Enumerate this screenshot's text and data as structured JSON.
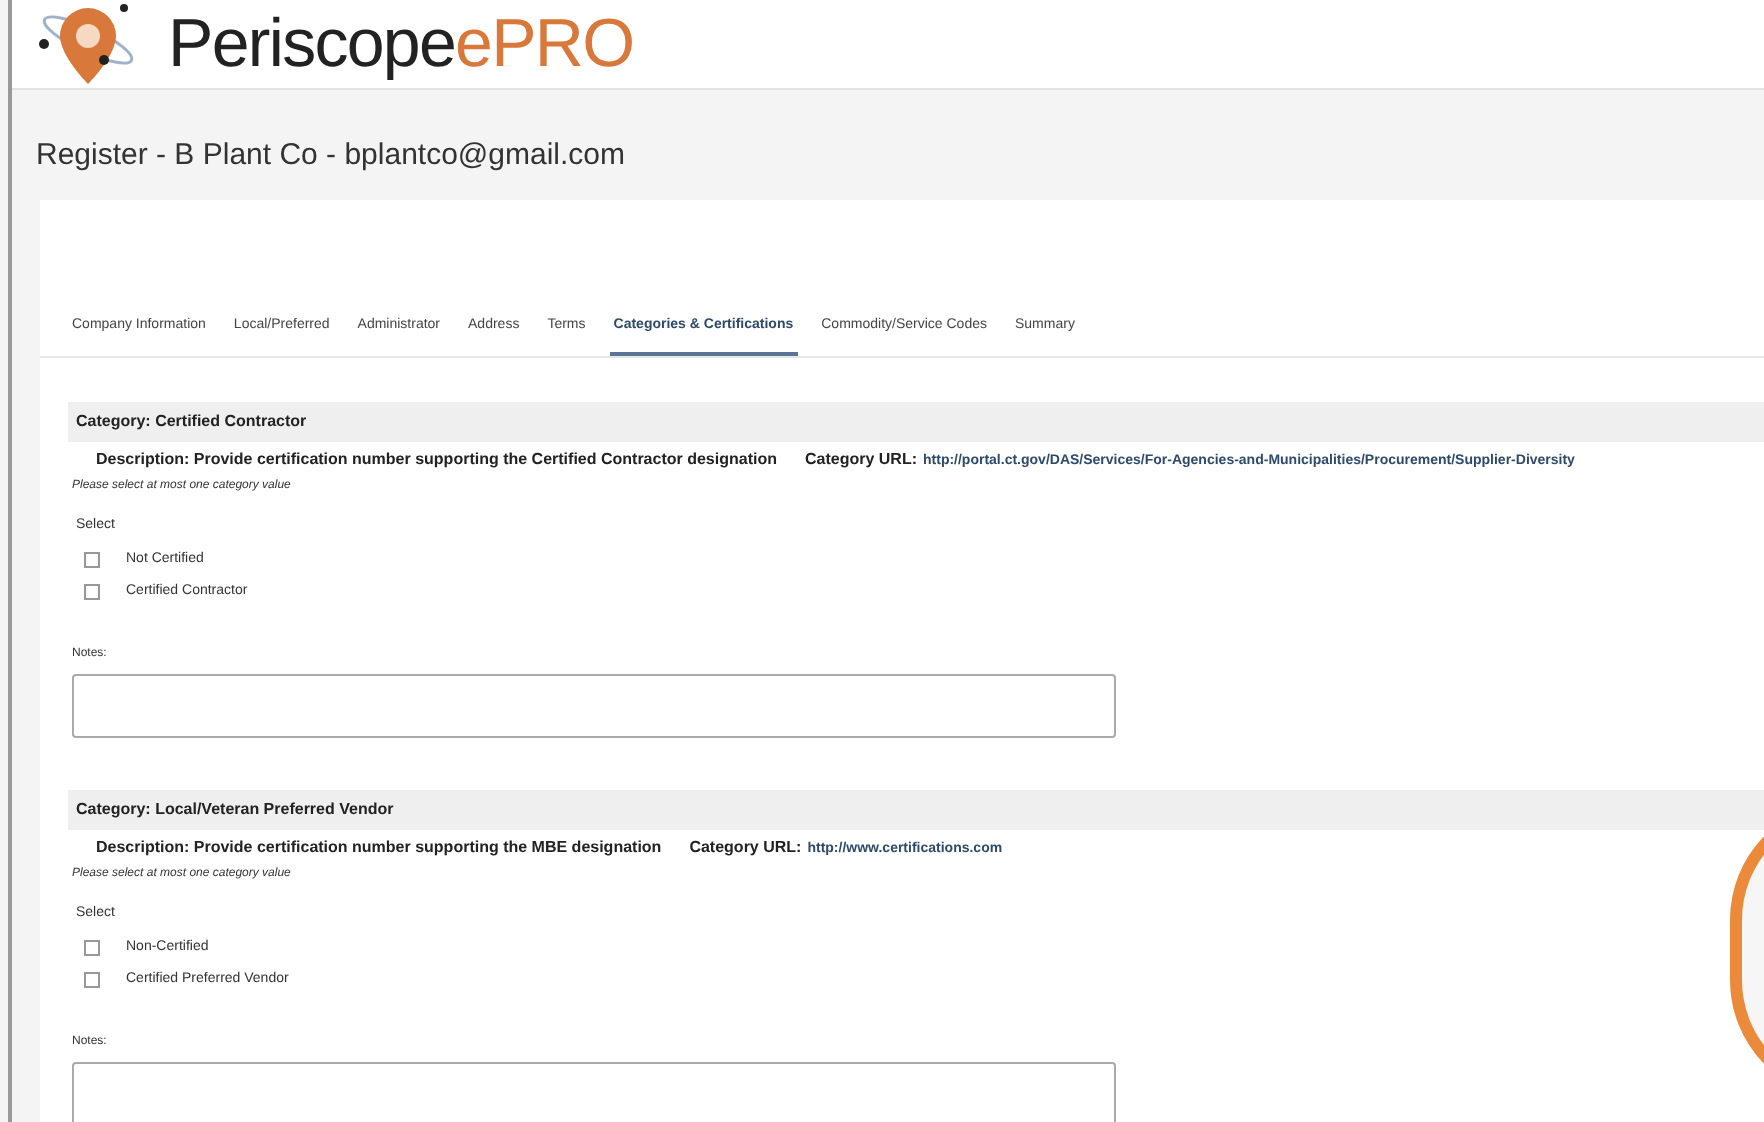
{
  "brand": {
    "name": "Periscope",
    "suffix": "ePRO"
  },
  "page_title": "Register - B Plant Co - bplantco@gmail.com",
  "tabs": [
    {
      "label": "Company Information",
      "selected": false
    },
    {
      "label": "Local/Preferred",
      "selected": false
    },
    {
      "label": "Administrator",
      "selected": false
    },
    {
      "label": "Address",
      "selected": false
    },
    {
      "label": "Terms",
      "selected": false
    },
    {
      "label": "Categories & Certifications",
      "selected": true
    },
    {
      "label": "Commodity/Service Codes",
      "selected": false
    },
    {
      "label": "Summary",
      "selected": false
    }
  ],
  "categories": [
    {
      "title": "Category: Certified Contractor",
      "description": "Description: Provide certification number supporting the Certified Contractor designation",
      "url_label": "Category URL:",
      "url": "http://portal.ct.gov/DAS/Services/For-Agencies-and-Municipalities/Procurement/Supplier-Diversity",
      "hint": "Please select at most one category value",
      "select_label": "Select",
      "options": [
        {
          "label": "Not Certified",
          "checked": false
        },
        {
          "label": "Certified Contractor",
          "checked": false
        }
      ],
      "notes_label": "Notes:"
    },
    {
      "title": "Category: Local/Veteran Preferred Vendor",
      "description": "Description: Provide certification number supporting the MBE designation",
      "url_label": "Category URL:",
      "url": "http://www.certifications.com",
      "hint": "Please select at most one category value",
      "select_label": "Select",
      "options": [
        {
          "label": "Non-Certified",
          "checked": false
        },
        {
          "label": "Certified Preferred Vendor",
          "checked": false
        }
      ],
      "notes_label": "Notes:"
    }
  ]
}
